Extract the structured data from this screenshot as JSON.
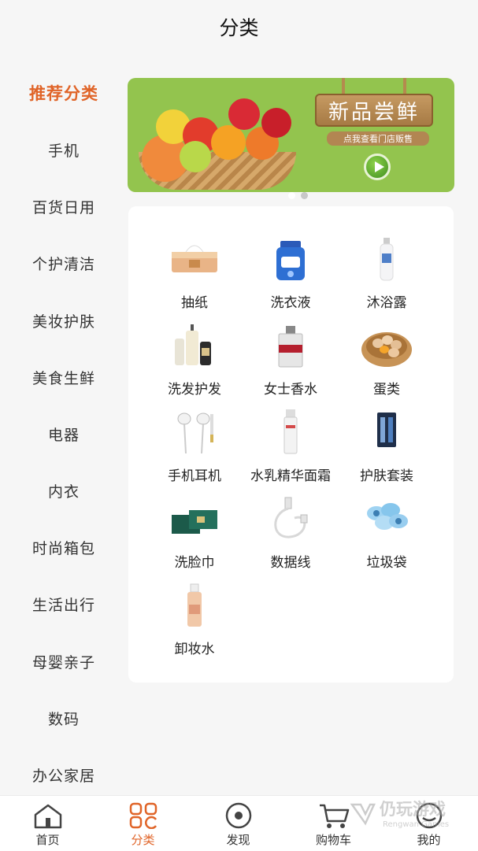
{
  "header": {
    "title": "分类"
  },
  "sidebar": {
    "items": [
      {
        "label": "推荐分类",
        "active": true
      },
      {
        "label": "手机"
      },
      {
        "label": "百货日用"
      },
      {
        "label": "个护清洁"
      },
      {
        "label": "美妆护肤"
      },
      {
        "label": "美食生鲜"
      },
      {
        "label": "电器"
      },
      {
        "label": "内衣"
      },
      {
        "label": "时尚箱包"
      },
      {
        "label": "生活出行"
      },
      {
        "label": "母婴亲子"
      },
      {
        "label": "数码"
      },
      {
        "label": "办公家居"
      }
    ]
  },
  "banner": {
    "title": "新品尝鲜",
    "subtitle": "点我查看门店贩售",
    "page_count": 2,
    "active_page": 1
  },
  "categories": [
    {
      "label": "抽纸",
      "icon": "tissue-box-icon"
    },
    {
      "label": "洗衣液",
      "icon": "laundry-detergent-icon"
    },
    {
      "label": "沐浴露",
      "icon": "body-wash-icon"
    },
    {
      "label": "洗发护发",
      "icon": "shampoo-icon"
    },
    {
      "label": "女士香水",
      "icon": "perfume-icon"
    },
    {
      "label": "蛋类",
      "icon": "eggs-icon"
    },
    {
      "label": "手机耳机",
      "icon": "earphones-icon"
    },
    {
      "label": "水乳精华面霜",
      "icon": "skincare-bottle-icon"
    },
    {
      "label": "护肤套装",
      "icon": "skincare-set-icon"
    },
    {
      "label": "洗脸巾",
      "icon": "face-towel-icon"
    },
    {
      "label": "数据线",
      "icon": "data-cable-icon"
    },
    {
      "label": "垃圾袋",
      "icon": "garbage-bag-icon"
    },
    {
      "label": "卸妆水",
      "icon": "makeup-remover-icon"
    }
  ],
  "tabbar": {
    "tabs": [
      {
        "label": "首页",
        "icon": "home-icon"
      },
      {
        "label": "分类",
        "icon": "category-icon",
        "active": true
      },
      {
        "label": "发现",
        "icon": "discover-icon"
      },
      {
        "label": "购物车",
        "icon": "cart-icon"
      },
      {
        "label": "我的",
        "icon": "profile-icon"
      }
    ]
  },
  "watermark": {
    "text": "仍玩游戏",
    "subtext": "Rengwan Games"
  },
  "colors": {
    "accent": "#e06428",
    "banner_bg": "#93c44e",
    "background": "#f6f6f6"
  }
}
